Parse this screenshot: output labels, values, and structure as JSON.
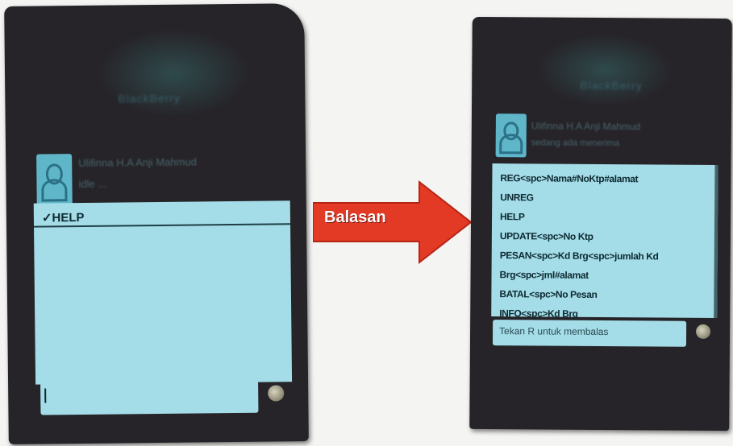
{
  "left_phone": {
    "header_title": "BlackBerry",
    "contact_name": "Ulifinna H.A Anji Mahmud",
    "contact_status": "idle ...",
    "message": "✓HELP",
    "input_value": ""
  },
  "arrow": {
    "label": "Balasan",
    "color": "#e23a24"
  },
  "right_phone": {
    "header_title": "BlackBerry",
    "contact_name": "Ulifinna H.A Anji Mahmud",
    "contact_status": "sedang ada menerima",
    "reply_lines": [
      "REG<spc>Nama#NoKtp#alamat",
      "UNREG",
      "HELP",
      "UPDATE<spc>No Ktp",
      "PESAN<spc>Kd Brg<spc>jumlah Kd",
      "Brg<spc>jml#alamat",
      "BATAL<spc>No Pesan",
      "INFO<spc>Kd Brg"
    ],
    "input_placeholder": "Tekan R untuk membalas"
  }
}
